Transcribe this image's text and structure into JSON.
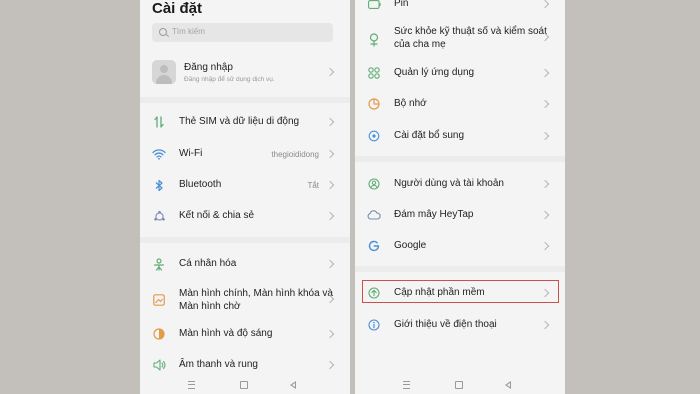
{
  "left": {
    "title": "Cài đặt",
    "search_placeholder": "Tìm kiếm",
    "login": {
      "title": "Đăng nhập",
      "subtitle": "Đăng nhập để sử dụng dịch vụ."
    },
    "items": [
      {
        "label": "Thẻ SIM và dữ liệu di động",
        "icon": "sim-data-icon"
      },
      {
        "label": "Wi-Fi",
        "value": "thegioididong",
        "icon": "wifi-icon"
      },
      {
        "label": "Bluetooth",
        "value": "Tắt",
        "icon": "bluetooth-icon"
      },
      {
        "label": "Kết nối & chia sẻ",
        "icon": "connection-share-icon"
      },
      {
        "label": "Cá nhân hóa",
        "icon": "personalization-icon"
      },
      {
        "label_line1": "Màn hình chính, Màn hình khóa và",
        "label_line2": "Màn hình chờ",
        "icon": "home-screen-icon"
      },
      {
        "label": "Màn hình và độ sáng",
        "icon": "brightness-icon"
      },
      {
        "label": "Âm thanh và rung",
        "icon": "sound-icon"
      }
    ]
  },
  "right": {
    "items": [
      {
        "label": "Pin",
        "icon": "battery-icon"
      },
      {
        "label_line1": "Sức khỏe kỹ thuật số và kiểm soát",
        "label_line2": "của cha mẹ",
        "icon": "digital-wellbeing-icon"
      },
      {
        "label": "Quản lý ứng dụng",
        "icon": "app-management-icon"
      },
      {
        "label": "Bộ nhớ",
        "icon": "storage-icon"
      },
      {
        "label": "Cài đặt bổ sung",
        "icon": "additional-settings-icon"
      },
      {
        "label": "Người dùng và tài khoản",
        "icon": "users-accounts-icon"
      },
      {
        "label": "Đám mây HeyTap",
        "icon": "cloud-icon"
      },
      {
        "label": "Google",
        "icon": "google-icon"
      },
      {
        "label": "Cập nhật phần mềm",
        "icon": "software-update-icon"
      },
      {
        "label": "Giới thiệu về điện thoại",
        "icon": "about-phone-icon"
      }
    ]
  },
  "colors": {
    "icon_green": "#5fae74",
    "highlight": "#c9504c",
    "background": "#c3c0bc"
  }
}
